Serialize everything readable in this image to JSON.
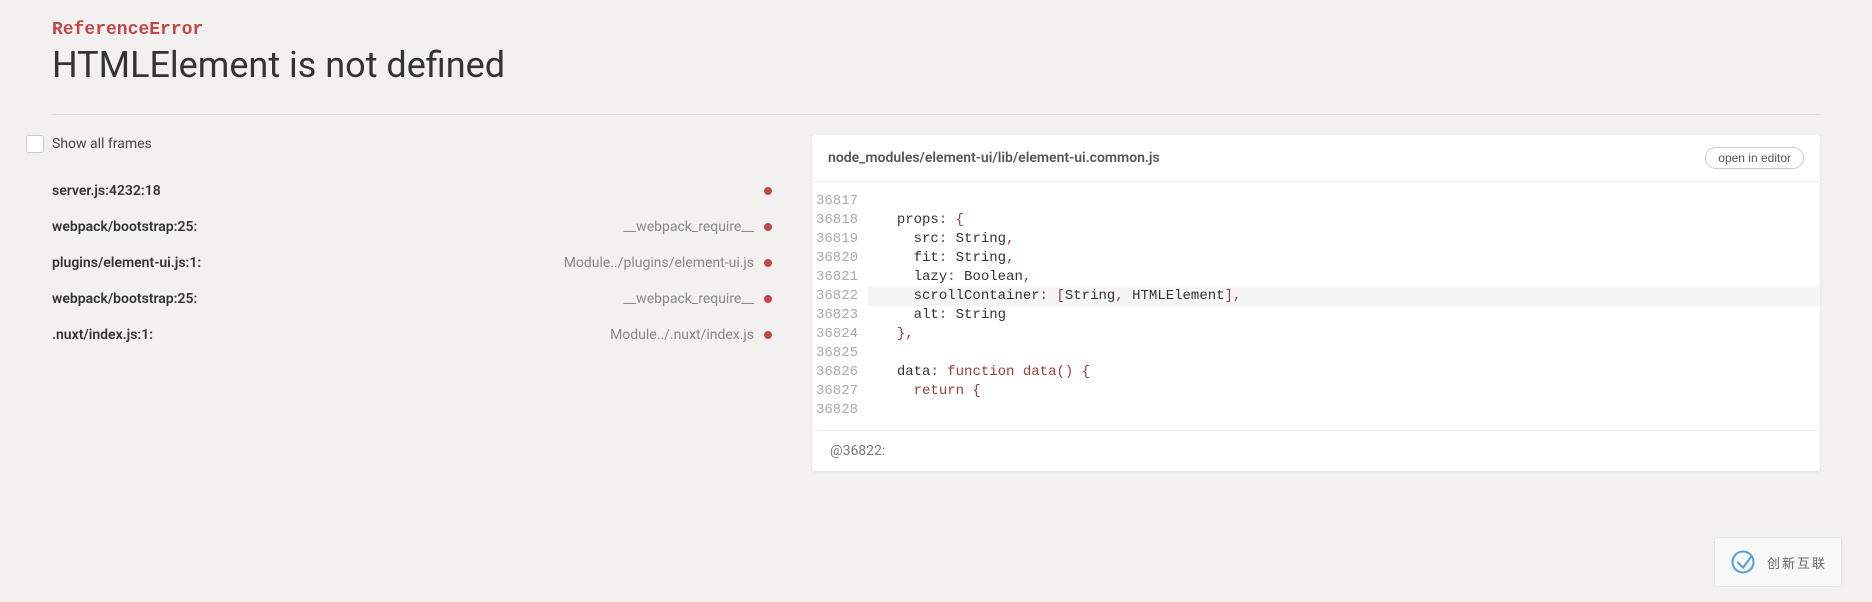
{
  "error": {
    "type": "ReferenceError",
    "message": "HTMLElement is not defined"
  },
  "showAllFramesLabel": "Show all frames",
  "frames": [
    {
      "left": "server.js:4232:18",
      "right": ""
    },
    {
      "left": "webpack/bootstrap:25:",
      "right": "__webpack_require__"
    },
    {
      "left": "plugins/element-ui.js:1:",
      "right": "Module../plugins/element-ui.js"
    },
    {
      "left": "webpack/bootstrap:25:",
      "right": "__webpack_require__"
    },
    {
      "left": ".nuxt/index.js:1:",
      "right": "Module../.nuxt/index.js"
    }
  ],
  "codePanel": {
    "filePath": "node_modules/element-ui/lib/element-ui.common.js",
    "openInEditorLabel": "open in editor",
    "gutter": [
      "36817",
      "36818",
      "36819",
      "36820",
      "36821",
      "36822",
      "36823",
      "36824",
      "36825",
      "36826",
      "36827",
      "36828"
    ],
    "lines": {
      "l0": "",
      "l1_a": "  props",
      "l1_b": ": {",
      "l2_a": "    src",
      "l2_b": ": ",
      "l2_c": "String",
      "l2_d": ",",
      "l3_a": "    fit",
      "l3_b": ": ",
      "l3_c": "String",
      "l3_d": ",",
      "l4_a": "    lazy",
      "l4_b": ": ",
      "l4_c": "Boolean",
      "l4_d": ",",
      "l5_a": "    scrollContainer",
      "l5_b": ": [",
      "l5_c": "String",
      "l5_d": ", ",
      "l5_e": "HTMLElement",
      "l5_f": "],",
      "l6_a": "    alt",
      "l6_b": ": ",
      "l6_c": "String",
      "l7": "  },",
      "l8": "",
      "l9_a": "  data",
      "l9_b": ": ",
      "l9_c": "function",
      "l9_d": " ",
      "l9_e": "data",
      "l9_f": "() {",
      "l10_a": "    return",
      "l10_b": " {",
      "l11": ""
    },
    "footer": "@36822:"
  },
  "badge": {
    "text": "创新互联"
  }
}
